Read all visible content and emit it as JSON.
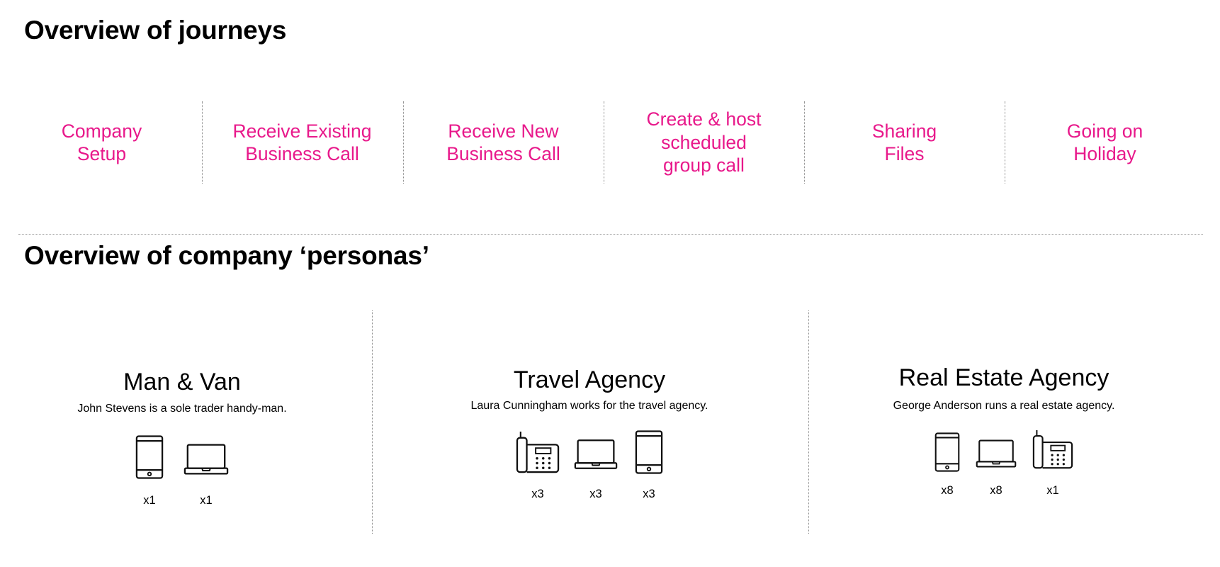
{
  "sections": {
    "journeys_title": "Overview of journeys",
    "personas_title": "Overview of company ‘personas’"
  },
  "colors": {
    "accent": "#e8198b",
    "text": "#000000",
    "divider": "#8c8c8c"
  },
  "journeys": [
    {
      "label": "Company\nSetup"
    },
    {
      "label": "Receive Existing\nBusiness Call"
    },
    {
      "label": "Receive New\nBusiness Call"
    },
    {
      "label": "Create & host\nscheduled\ngroup call"
    },
    {
      "label": "Sharing\nFiles"
    },
    {
      "label": "Going on\nHoliday"
    }
  ],
  "personas": [
    {
      "name": "Man & Van",
      "description": "John Stevens is a sole trader handy-man.",
      "devices": [
        {
          "icon": "smartphone-icon",
          "count": "x1"
        },
        {
          "icon": "laptop-icon",
          "count": "x1"
        }
      ]
    },
    {
      "name": "Travel Agency",
      "description": "Laura Cunningham works for the travel agency.",
      "devices": [
        {
          "icon": "desk-phone-icon",
          "count": "x3"
        },
        {
          "icon": "laptop-icon",
          "count": "x3"
        },
        {
          "icon": "smartphone-icon",
          "count": "x3"
        }
      ]
    },
    {
      "name": "Real Estate Agency",
      "description": "George Anderson runs a real estate agency.",
      "devices": [
        {
          "icon": "smartphone-icon",
          "count": "x8"
        },
        {
          "icon": "laptop-icon",
          "count": "x8"
        },
        {
          "icon": "desk-phone-icon",
          "count": "x1"
        }
      ]
    }
  ]
}
